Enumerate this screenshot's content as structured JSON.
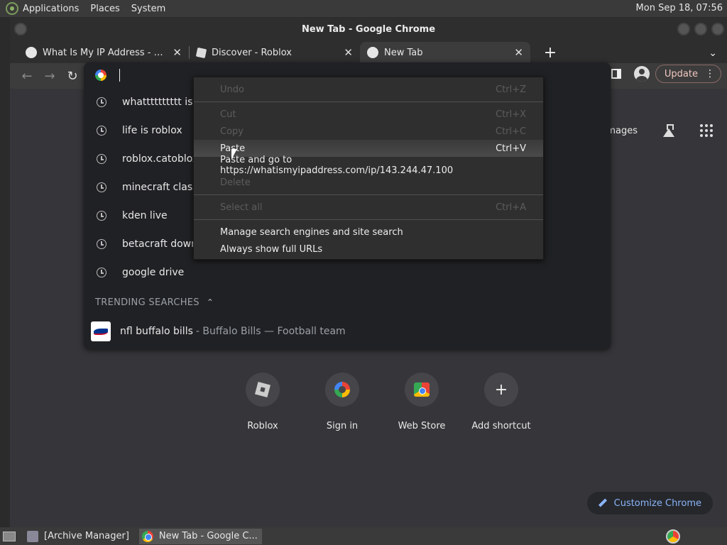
{
  "system_bar": {
    "menus": [
      "Applications",
      "Places",
      "System"
    ],
    "clock": "Mon Sep 18, 07:56"
  },
  "window": {
    "title": "New Tab - Google Chrome"
  },
  "tabs": [
    {
      "title": "What Is My IP Address - See Your",
      "icon": "globe-icon",
      "active": false
    },
    {
      "title": "Discover - Roblox",
      "icon": "roblox-icon",
      "active": false
    },
    {
      "title": "New Tab",
      "icon": "chrome-icon",
      "active": true
    }
  ],
  "toolbar": {
    "update_label": "Update"
  },
  "omnibox": {
    "suggestions": [
      {
        "text": "whatttttttttt is m"
      },
      {
        "text": "life is roblox"
      },
      {
        "text": "roblox.catoblox i"
      },
      {
        "text": "minecraft classic"
      },
      {
        "text": "kden live"
      },
      {
        "text": "betacraft downlo"
      },
      {
        "text": "google drive"
      }
    ],
    "trending_header": "TRENDING SEARCHES",
    "trending": [
      {
        "main": "nfl buffalo bills",
        "sub": "- Buffalo Bills — Football team"
      }
    ]
  },
  "context_menu": {
    "items": [
      {
        "label": "Undo",
        "shortcut": "Ctrl+Z",
        "disabled": true
      },
      {
        "sep": true
      },
      {
        "label": "Cut",
        "shortcut": "Ctrl+X",
        "disabled": true
      },
      {
        "label": "Copy",
        "shortcut": "Ctrl+C",
        "disabled": true
      },
      {
        "label": "Paste",
        "shortcut": "Ctrl+V",
        "disabled": false,
        "hover": true
      },
      {
        "label": "Paste and go to https://whatismyipaddress.com/ip/143.244.47.100",
        "shortcut": "",
        "disabled": false
      },
      {
        "label": "Delete",
        "shortcut": "",
        "disabled": true
      },
      {
        "sep": true
      },
      {
        "label": "Select all",
        "shortcut": "Ctrl+A",
        "disabled": true
      },
      {
        "sep": true
      },
      {
        "label": "Manage search engines and site search",
        "shortcut": "",
        "disabled": false
      },
      {
        "label": "Always show full URLs",
        "shortcut": "",
        "disabled": false
      }
    ]
  },
  "ntp": {
    "images_link": "Images",
    "shortcuts": [
      {
        "label": "Roblox",
        "icon": "roblox-icon"
      },
      {
        "label": "Sign in",
        "icon": "google-icon"
      },
      {
        "label": "Web Store",
        "icon": "webstore-icon"
      },
      {
        "label": "Add shortcut",
        "icon": "plus-icon"
      }
    ],
    "customize_label": "Customize Chrome"
  },
  "taskbar": {
    "items": [
      {
        "label": "[Archive Manager]",
        "active": false
      },
      {
        "label": "New Tab - Google C...",
        "active": true
      }
    ]
  },
  "colors": {
    "accent_link": "#8ab4f8",
    "update_text": "#f0c8c0"
  }
}
